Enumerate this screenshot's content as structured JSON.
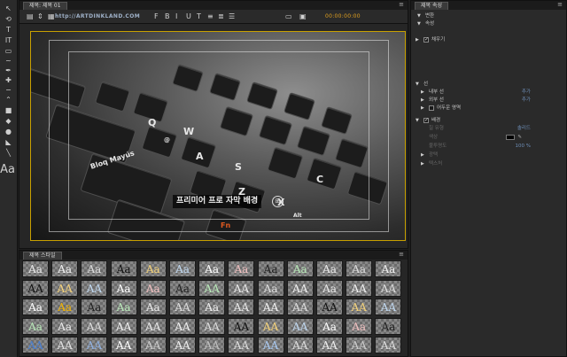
{
  "tools": [
    {
      "icon": "selection-arrow-icon",
      "glyph": "↖"
    },
    {
      "icon": "rotate-icon",
      "glyph": "⟲"
    },
    {
      "icon": "type-tool-icon",
      "glyph": "T"
    },
    {
      "icon": "vertical-type-icon",
      "glyph": "IT"
    },
    {
      "icon": "area-type-icon",
      "glyph": "▭"
    },
    {
      "icon": "path-type-icon",
      "glyph": "~"
    },
    {
      "icon": "pen-tool-icon",
      "glyph": "✒"
    },
    {
      "icon": "add-anchor-icon",
      "glyph": "✚"
    },
    {
      "icon": "delete-anchor-icon",
      "glyph": "−"
    },
    {
      "icon": "convert-anchor-icon",
      "glyph": "⌃"
    },
    {
      "icon": "rectangle-tool-icon",
      "glyph": "■"
    },
    {
      "icon": "clipped-rectangle-icon",
      "glyph": "◆"
    },
    {
      "icon": "ellipse-tool-icon",
      "glyph": "●"
    },
    {
      "icon": "wedge-tool-icon",
      "glyph": "◣"
    },
    {
      "icon": "line-tool-icon",
      "glyph": "╲"
    }
  ],
  "tools_big": {
    "glyph": "Aa",
    "icon": "text-style-icon"
  },
  "title_panel": {
    "tab_label": "제목: 제목 01",
    "menu_glyph": "≡",
    "watermark": "http://ARTDINKLAND.COM",
    "timecode": "00:00:00:00",
    "toolbar_buttons": [
      {
        "name": "new-title-icon",
        "glyph": "▤"
      },
      {
        "name": "roll-crawl-icon",
        "glyph": "⇕"
      },
      {
        "name": "templates-icon",
        "glyph": "▦"
      },
      {
        "name": "font-family-icon",
        "glyph": "F"
      },
      {
        "name": "bold-icon",
        "glyph": "B"
      },
      {
        "name": "italic-icon",
        "glyph": "I"
      },
      {
        "name": "underline-icon",
        "glyph": "U"
      },
      {
        "name": "size-icon",
        "glyph": "T"
      },
      {
        "name": "align-left-icon",
        "glyph": "≡"
      },
      {
        "name": "align-center-icon",
        "glyph": "≣"
      },
      {
        "name": "align-right-icon",
        "glyph": "☰"
      },
      {
        "name": "tab-stops-icon",
        "glyph": "▭"
      },
      {
        "name": "show-background-icon",
        "glyph": "▣"
      }
    ]
  },
  "canvas": {
    "subtitle_text": "프리미어 프로 자막 배경",
    "subtitle_icon_glyph": "⊞",
    "key_labels": {
      "shift_label": "Bloq Mayús",
      "q": "Q",
      "w": "W",
      "a": "A",
      "s": "S",
      "z": "Z",
      "x": "X",
      "c": "C",
      "fn": "Fn",
      "alt": "Alt",
      "at": "@"
    }
  },
  "styles_panel": {
    "tab_label": "제목 스타일",
    "menu_glyph": "≡",
    "swatches": [
      [
        "Aa",
        "Aa",
        "Aa",
        "Aa",
        "Aa",
        "Aa",
        "Aa",
        "Aa",
        "Aa",
        "Aa",
        "Aa",
        "Aa",
        "Aa"
      ],
      [
        "AA",
        "AA",
        "AA",
        "Aa",
        "Aa",
        "Aa",
        "AA",
        "AA",
        "Aa",
        "AA",
        "Aa",
        "AA",
        "AA"
      ],
      [
        "Aa",
        "Aa",
        "Aa",
        "Aa",
        "Aa",
        "AA",
        "Aa",
        "AA",
        "AA",
        "AA",
        "AA",
        "AA",
        "AA"
      ],
      [
        "Aa",
        "Aa",
        "AA",
        "AA",
        "AA",
        "AA",
        "AA",
        "AA",
        "AA",
        "AA",
        "Aa",
        "Aa",
        "Aa"
      ],
      [
        "AA",
        "AA",
        "AA",
        "AA",
        "AA",
        "AA",
        "AA",
        "AA",
        "AA",
        "AA",
        "AA",
        "AA",
        "AA"
      ]
    ]
  },
  "props_panel": {
    "tab_label": "제목 속성",
    "menu_glyph": "≡",
    "rows": [
      {
        "label": "변환",
        "tri": "▼"
      },
      {
        "label": "속성",
        "tri": "▼"
      },
      {
        "label": "채우기",
        "tri": "▶",
        "cb": "on"
      },
      {
        "label": "선",
        "tri": "▼"
      },
      {
        "label": "내부 선",
        "tri": "▶",
        "val": "추가"
      },
      {
        "label": "외부 선",
        "tri": "▶",
        "val": "추가"
      },
      {
        "label": "어두운 영역",
        "tri": "▶",
        "cb": "off"
      },
      {
        "label": "배경",
        "tri": "▼",
        "cb": "on"
      },
      {
        "label": "칠 유형",
        "dim": true,
        "val": "솔리드"
      },
      {
        "label": "색상",
        "dim": true,
        "swatch": true
      },
      {
        "label": "불투명도",
        "dim": true,
        "val": "100 %"
      },
      {
        "label": "광택",
        "tri": "▶",
        "dim": true
      },
      {
        "label": "텍스처",
        "tri": "▶",
        "dim": true
      }
    ]
  }
}
